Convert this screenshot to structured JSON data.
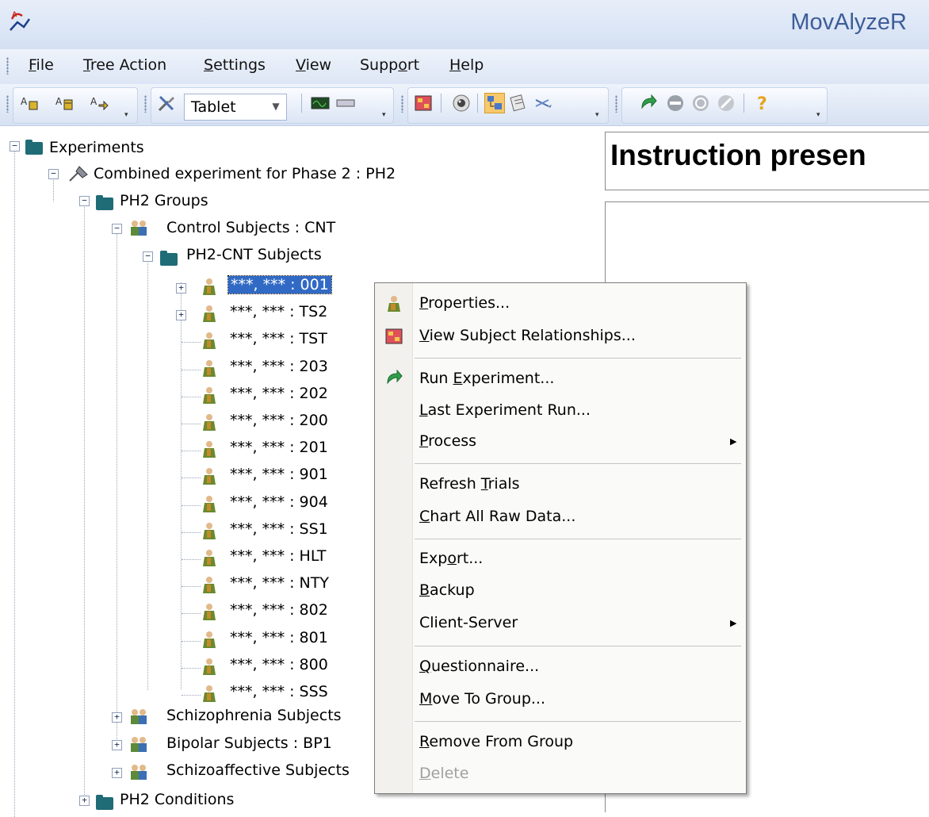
{
  "app": {
    "title": "MovAlyzeR"
  },
  "menubar": {
    "items": [
      {
        "pre": "",
        "u": "F",
        "post": "ile"
      },
      {
        "pre": "",
        "u": "T",
        "post": "ree Action"
      },
      {
        "pre": "",
        "u": "S",
        "post": "ettings"
      },
      {
        "pre": "",
        "u": "V",
        "post": "iew"
      },
      {
        "pre": "Supp",
        "u": "o",
        "post": "rt"
      },
      {
        "pre": "",
        "u": "H",
        "post": "elp"
      }
    ]
  },
  "toolbar": {
    "device_combo_value": "Tablet"
  },
  "tree": {
    "root": "Experiments",
    "experiment": "Combined experiment for Phase 2 : PH2",
    "groups_folder": "PH2 Groups",
    "control_group": "Control Subjects : CNT",
    "cnt_subjects_folder": "PH2-CNT Subjects",
    "subjects": [
      "***, *** : 001",
      "***, *** : TS2",
      "***, *** : TST",
      "***, *** : 203",
      "***, *** : 202",
      "***, *** : 200",
      "***, *** : 201",
      "***, *** : 901",
      "***, *** : 904",
      "***, *** : SS1",
      "***, *** : HLT",
      "***, *** : NTY",
      "***, *** : 802",
      "***, *** : 801",
      "***, *** : 800",
      "***, *** : SSS"
    ],
    "other_groups": [
      "Schizophrenia Subjects",
      "Bipolar Subjects : BP1",
      "Schizoaffective Subjects"
    ],
    "conditions_folder": "PH2 Conditions"
  },
  "right_pane": {
    "header": "Instruction presen"
  },
  "context_menu": {
    "items": [
      {
        "pre": "",
        "u": "P",
        "post": "roperties..."
      },
      {
        "pre": "",
        "u": "V",
        "post": "iew Subject Relationships..."
      },
      {
        "pre": "Run ",
        "u": "E",
        "post": "xperiment..."
      },
      {
        "pre": "",
        "u": "L",
        "post": "ast Experiment Run..."
      },
      {
        "pre": "",
        "u": "P",
        "post": "rocess"
      },
      {
        "pre": "Refresh ",
        "u": "T",
        "post": "rials"
      },
      {
        "pre": "",
        "u": "C",
        "post": "hart All Raw Data..."
      },
      {
        "pre": "Exp",
        "u": "o",
        "post": "rt..."
      },
      {
        "pre": "",
        "u": "B",
        "post": "ackup"
      },
      {
        "pre": "Client-Server",
        "u": "",
        "post": ""
      },
      {
        "pre": "",
        "u": "Q",
        "post": "uestionnaire..."
      },
      {
        "pre": "",
        "u": "M",
        "post": "ove To Group..."
      },
      {
        "pre": "",
        "u": "R",
        "post": "emove From Group"
      },
      {
        "pre": "",
        "u": "D",
        "post": "elete"
      }
    ]
  },
  "colors": {
    "selection": "#316ac5",
    "title_text": "#3d5d99",
    "folder": "#1f6b76"
  }
}
